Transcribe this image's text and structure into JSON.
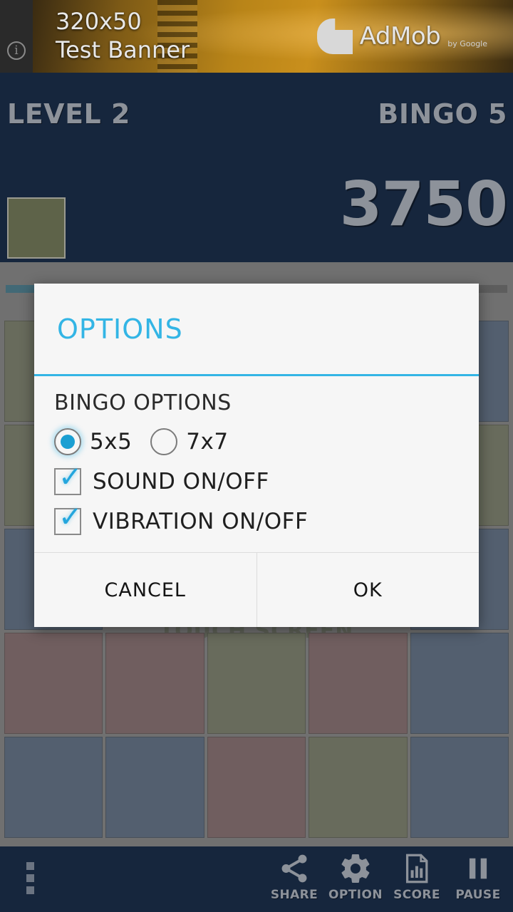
{
  "ad": {
    "line1": "320x50",
    "line2": "Test Banner",
    "brand": "AdMob",
    "by": "by Google",
    "info_icon": "info-icon"
  },
  "header": {
    "level": "LEVEL 2",
    "bingo": "BINGO 5",
    "score": "3750",
    "next_piece_color": "#5e6349"
  },
  "board": {
    "touch_hint": "TOUCH SCREEN",
    "progress_percent": 13,
    "progress_color": "#1d5f76",
    "tiles": [
      "olive",
      "empty",
      "empty",
      "empty",
      "blue",
      "olive",
      "empty",
      "empty",
      "empty",
      "olive",
      "blue",
      "empty",
      "empty",
      "empty",
      "blue",
      "maroon",
      "maroon",
      "olive",
      "maroon",
      "blue",
      "blue",
      "blue",
      "maroon",
      "olive",
      "blue"
    ],
    "tile_colors": {
      "olive": "#5e6349",
      "blue": "#3a4f69",
      "maroon": "#6b4d4f"
    }
  },
  "dialog": {
    "title": "OPTIONS",
    "accent_color": "#33b5e5",
    "section_label": "BINGO OPTIONS",
    "radios": [
      {
        "label": "5x5",
        "checked": true
      },
      {
        "label": "7x7",
        "checked": false
      }
    ],
    "checkboxes": [
      {
        "label": "SOUND ON/OFF",
        "checked": true
      },
      {
        "label": "VIBRATION ON/OFF",
        "checked": true
      }
    ],
    "cancel_label": "CANCEL",
    "ok_label": "OK"
  },
  "bottom_bar": {
    "overflow_icon": "overflow-menu-icon",
    "actions": [
      {
        "label": "SHARE",
        "icon": "share-icon"
      },
      {
        "label": "OPTION",
        "icon": "gear-icon"
      },
      {
        "label": "SCORE",
        "icon": "score-document-icon"
      },
      {
        "label": "PAUSE",
        "icon": "pause-icon"
      }
    ]
  }
}
